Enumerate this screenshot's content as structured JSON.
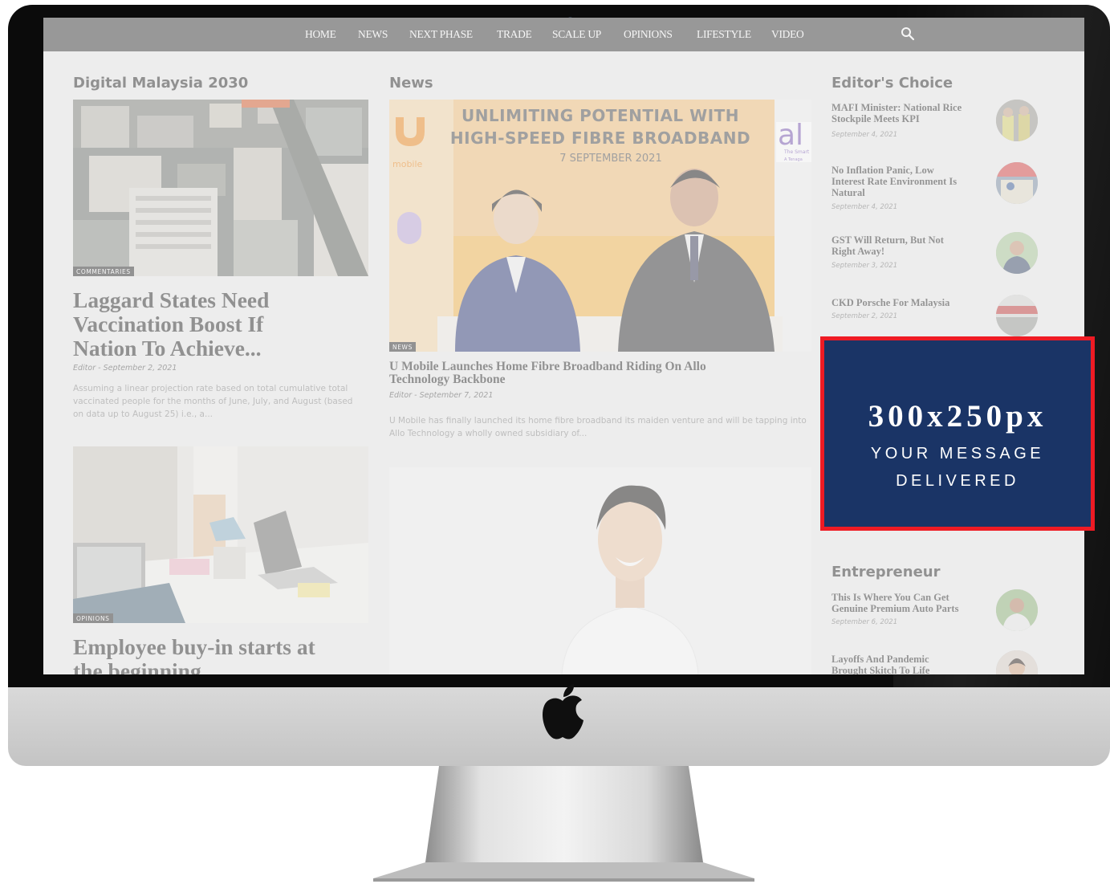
{
  "site": {
    "nav": [
      "HOME",
      "NEWS",
      "NEXT PHASE",
      "TRADE",
      "SCALE UP",
      "OPINIONS",
      "LIFESTYLE",
      "VIDEO"
    ],
    "search_icon": "search-icon"
  },
  "left_column": {
    "section_title": "Digital Malaysia 2030",
    "article1": {
      "category": "COMMENTARIES",
      "headline_lines": [
        "Laggard States Need",
        "Vaccination Boost If",
        "Nation To Achieve..."
      ],
      "meta": "Editor - September 2, 2021",
      "excerpt_lines": [
        "Assuming a linear projection rate based on total cumulative total",
        "vaccinated people for the months of June, July, and August (based",
        "on data up to August 25) i.e., a..."
      ]
    },
    "article2": {
      "category": "OPINIONS",
      "headline_lines": [
        "Employee buy-in starts at",
        "the beginning"
      ]
    }
  },
  "middle_column": {
    "section_title": "News",
    "banner": {
      "line1": "UNLIMITING POTENTIAL WITH",
      "line2": "HIGH-SPEED FIBRE BROADBAND",
      "date": "7 SEPTEMBER 2021",
      "left_logo": "mobile",
      "right_logo": "al",
      "right_sub1": "The Smart",
      "right_sub2": "A Tenaga"
    },
    "article1": {
      "category": "NEWS",
      "headline_lines": [
        "U Mobile Launches Home Fibre Broadband Riding On Allo",
        "Technology Backbone"
      ],
      "meta": "Editor - September 7, 2021",
      "excerpt_lines": [
        "U Mobile has finally launched its home fibre broadband its maiden venture and will be tapping into",
        "Allo Technology a wholly owned subsidiary of..."
      ]
    }
  },
  "right_column": {
    "section_title": "Editor's Choice",
    "items": [
      {
        "title_lines": [
          "MAFI Minister: National Rice",
          "Stockpile Meets KPI"
        ],
        "date": "September 4, 2021"
      },
      {
        "title_lines": [
          "No Inflation Panic, Low",
          "Interest Rate Environment Is",
          "Natural"
        ],
        "date": "September 4, 2021"
      },
      {
        "title_lines": [
          "GST Will Return, But Not",
          "Right Away!"
        ],
        "date": "September 3, 2021"
      },
      {
        "title_lines": [
          "CKD Porsche For Malaysia"
        ],
        "date": "September 2, 2021"
      }
    ],
    "entrepreneur_title": "Entrepreneur",
    "entrepreneur_items": [
      {
        "title_lines": [
          "This Is Where You Can Get",
          "Genuine Premium Auto Parts"
        ],
        "date": "September 6, 2021"
      },
      {
        "title_lines": [
          "Layoffs And Pandemic",
          "Brought Skitch To Life"
        ]
      }
    ]
  },
  "ad": {
    "size": "300x250px",
    "line1": "YOUR MESSAGE",
    "line2": "DELIVERED",
    "background": "#1a3466",
    "border": "#ee1b24"
  },
  "device": {
    "logo_icon": "apple-logo-icon"
  }
}
